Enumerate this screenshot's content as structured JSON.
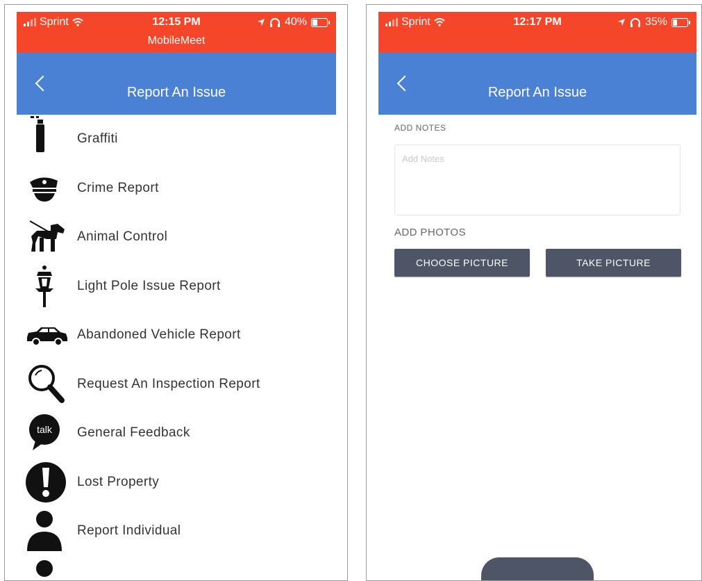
{
  "left": {
    "status": {
      "carrier": "Sprint",
      "time": "12:15 PM",
      "battery": "40%",
      "battery_level": 0.4,
      "app": "MobileMeet"
    },
    "nav": {
      "title": "Report An Issue"
    },
    "items": [
      {
        "label": "Graffiti",
        "icon": "spray-can-icon"
      },
      {
        "label": "Crime Report",
        "icon": "police-hat-icon"
      },
      {
        "label": "Animal Control",
        "icon": "dog-leash-icon"
      },
      {
        "label": "Light Pole Issue Report",
        "icon": "street-lamp-icon"
      },
      {
        "label": "Abandoned Vehicle Report",
        "icon": "car-icon"
      },
      {
        "label": "Request An Inspection Report",
        "icon": "magnifier-icon"
      },
      {
        "label": "General Feedback",
        "icon": "talk-bubble-icon",
        "icon_text": "talk"
      },
      {
        "label": "Lost Property",
        "icon": "exclamation-icon"
      },
      {
        "label": "Report Individual",
        "icon": "person-icon"
      }
    ]
  },
  "right": {
    "status": {
      "carrier": "Sprint",
      "time": "12:17 PM",
      "battery": "35%",
      "battery_level": 0.35
    },
    "nav": {
      "title": "Report An Issue"
    },
    "form": {
      "notes_label": "ADD NOTES",
      "notes_placeholder": "Add Notes",
      "photos_label": "ADD PHOTOS",
      "choose_label": "CHOOSE PICTURE",
      "take_label": "TAKE PICTURE"
    }
  },
  "colors": {
    "status_bg": "#f6462a",
    "nav_bg": "#4a81d4",
    "button_bg": "#4d5567"
  }
}
